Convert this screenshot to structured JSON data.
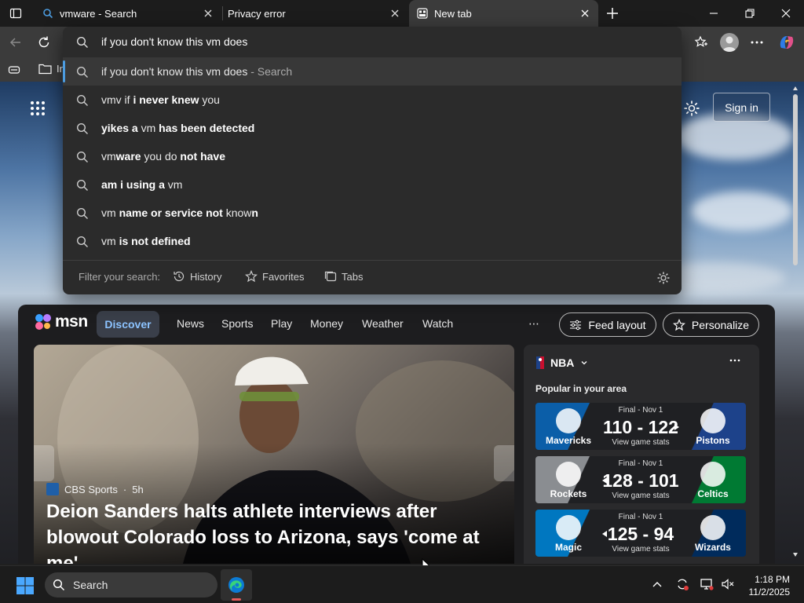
{
  "tabs": [
    {
      "title": "vmware - Search",
      "icon": "bing-search-icon"
    },
    {
      "title": "Privacy error",
      "icon": "warning-icon"
    },
    {
      "title": "New tab",
      "icon": "newtab-icon",
      "active": true
    }
  ],
  "toolbar": {
    "favbar_partial": "In"
  },
  "omnibox": {
    "value": "if you don't know this vm does",
    "suggestions": [
      {
        "plain": "if you don't know this vm does",
        "suffix": " - Search"
      },
      {
        "parts": [
          [
            "vm",
            false
          ],
          [
            "v",
            false
          ],
          [
            " if ",
            false
          ],
          [
            "i never knew",
            true
          ],
          [
            " you",
            false
          ]
        ]
      },
      {
        "parts": [
          [
            "yikes a",
            true
          ],
          [
            " vm ",
            false
          ],
          [
            "has been detected",
            true
          ]
        ]
      },
      {
        "parts": [
          [
            "vm",
            false
          ],
          [
            "ware",
            true
          ],
          [
            " you do ",
            false
          ],
          [
            "not have",
            true
          ]
        ]
      },
      {
        "parts": [
          [
            "am i using a",
            true
          ],
          [
            " vm",
            false
          ]
        ]
      },
      {
        "parts": [
          [
            "vm ",
            false
          ],
          [
            "name or service not",
            true
          ],
          [
            " know",
            false
          ],
          [
            "n",
            true
          ]
        ]
      },
      {
        "parts": [
          [
            "vm ",
            false
          ],
          [
            "is not defined",
            true
          ]
        ]
      }
    ],
    "filter_label": "Filter your search:",
    "filters": [
      "History",
      "Favorites",
      "Tabs"
    ]
  },
  "newtab": {
    "sign_in": "Sign in"
  },
  "msn": {
    "logo": "msn",
    "nav": [
      "Discover",
      "News",
      "Sports",
      "Play",
      "Money",
      "Weather",
      "Watch"
    ],
    "more": "⋯",
    "feed_layout": "Feed layout",
    "personalize": "Personalize",
    "hero": {
      "source": "CBS Sports",
      "age": "5h",
      "headline": "Deion Sanders halts athlete interviews after blowout Colorado loss to Arizona, says 'come at me'"
    },
    "nba": {
      "league": "NBA",
      "subtitle": "Popular in your area",
      "games": [
        {
          "status": "Final - Nov 1",
          "home": "Mavericks",
          "away": "Pistons",
          "score": "110 - 122",
          "stats": "View game stats",
          "arrow": "right",
          "left_color": "#0b5ea8",
          "right_color": "#1d428a"
        },
        {
          "status": "Final - Nov 1",
          "home": "Rockets",
          "away": "Celtics",
          "score": "128 - 101",
          "stats": "View game stats",
          "arrow": "left",
          "left_color": "#8a8d91",
          "right_color": "#007a33"
        },
        {
          "status": "Final - Nov 1",
          "home": "Magic",
          "away": "Wizards",
          "score": "125 - 94",
          "stats": "View game stats",
          "arrow": "left",
          "left_color": "#0077c0",
          "right_color": "#002b5c"
        }
      ]
    }
  },
  "taskbar": {
    "search_placeholder": "Search",
    "time": "1:18 PM",
    "date": "11/2/2025"
  }
}
